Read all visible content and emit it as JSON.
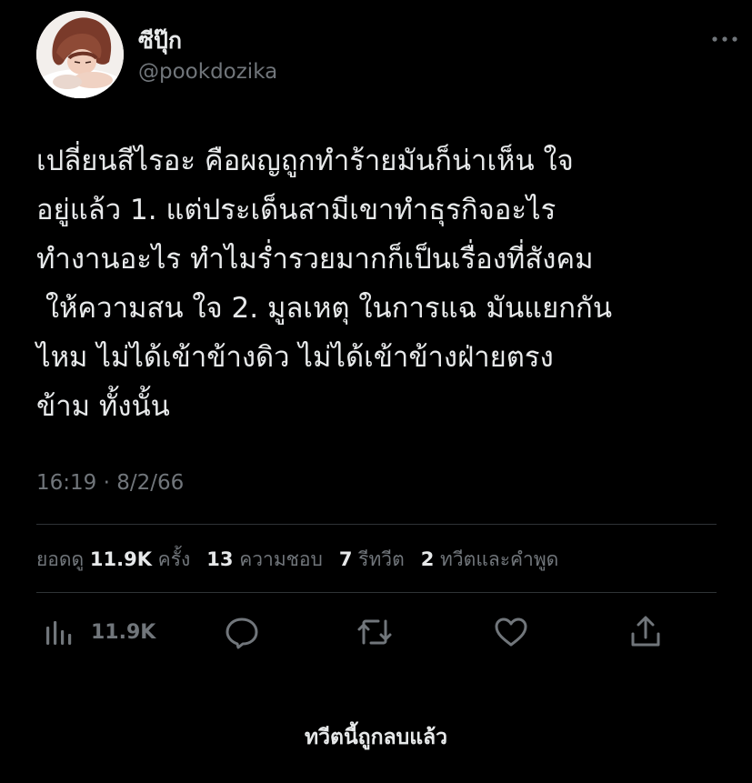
{
  "user": {
    "display_name": "ซีปุ๊ก",
    "handle": "@pookdozika",
    "avatar": "profile-photo"
  },
  "tweet": {
    "lines": [
      "เปลี่ยนสีไรอะ คือผญถูกทำร้ายมันก็น่าเห็น ใจ",
      "อยู่แล้ว 1. แต่ประเด็นสามีเขาทำธุรกิจอะไร",
      "ทำงานอะไร ทำไมร่ำรวยมากก็เป็นเรื่องที่สังคม",
      " ให้ความสน ใจ 2. มูลเหตุ ในการแฉ มันแยกกัน",
      "ไหม ไม่ได้เข้าข้างดิว ไม่ได้เข้าข้างฝ่ายตรง",
      "ข้าม ทั้งนั้น"
    ],
    "timestamp": "16:19 · 8/2/66"
  },
  "stats": {
    "views_label": "ยอดดู",
    "views_count": "11.9K",
    "views_suffix": "ครั้ง",
    "likes_count": "13",
    "likes_label": "ความชอบ",
    "retweets_count": "7",
    "retweets_label": "รีทวีต",
    "quotes_count": "2",
    "quotes_label": "ทวีตและคำพูด"
  },
  "actions": {
    "views_icon": "analytics-icon",
    "views_count": "11.9K",
    "reply_icon": "reply-icon",
    "retweet_icon": "retweet-icon",
    "like_icon": "heart-icon",
    "share_icon": "share-icon"
  },
  "footer": {
    "deleted_notice": "ทวีตนี้ถูกลบแล้ว"
  },
  "colors": {
    "background": "#000000",
    "text": "#e7e9ea",
    "secondary": "#71767b",
    "divider": "#2f3336"
  }
}
